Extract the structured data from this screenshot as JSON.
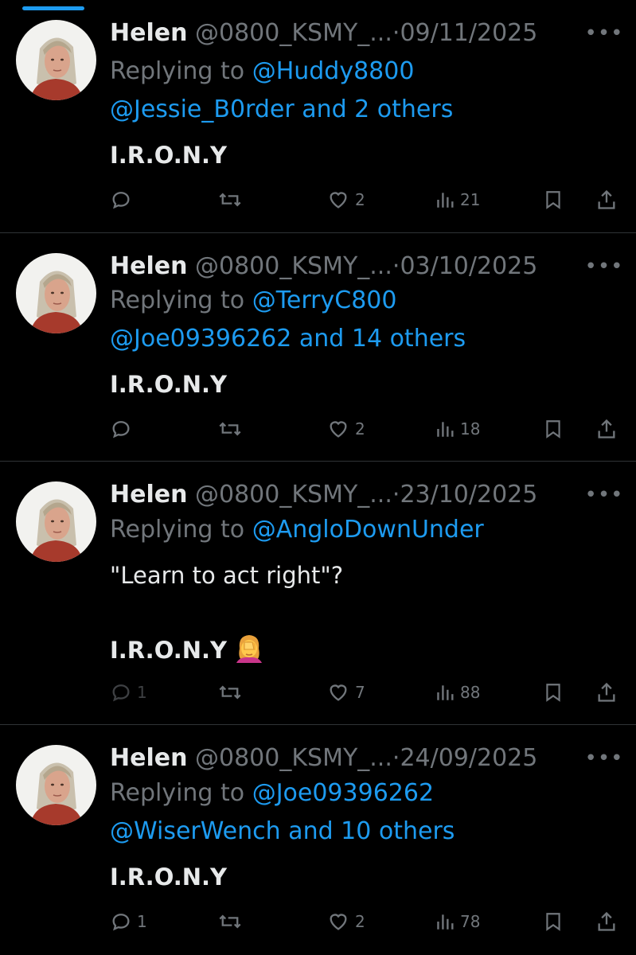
{
  "colors": {
    "background": "#000000",
    "text": "#e7e9ea",
    "muted": "#71767b",
    "accent": "#1d9bf0",
    "divider": "#2f3336"
  },
  "icons": {
    "reply": "reply-bubble-icon",
    "retweet": "retweet-icon",
    "like": "heart-icon",
    "views": "views-bar-chart-icon",
    "bookmark": "bookmark-icon",
    "share": "share-icon",
    "more": "more-dots-icon"
  },
  "tweets": [
    {
      "name": "Helen",
      "handle": "@0800_KSMY_...",
      "separator": "·",
      "date": "09/11/2025",
      "replying_label": "Replying to",
      "replying_first": "@Huddy8800",
      "replying_more": "@Jessie_B0rder and 2 others",
      "text_lines": [
        "I.R.O.N.Y"
      ],
      "reply_count": "",
      "like_count": "2",
      "view_count": "21"
    },
    {
      "name": "Helen",
      "handle": "@0800_KSMY_...",
      "separator": "·",
      "date": "03/10/2025",
      "replying_label": "Replying to",
      "replying_first": "@TerryC800",
      "replying_more": "@Joe09396262 and 14 others",
      "text_lines": [
        "I.R.O.N.Y"
      ],
      "reply_count": "",
      "like_count": "2",
      "view_count": "18"
    },
    {
      "name": "Helen",
      "handle": "@0800_KSMY_...",
      "separator": "·",
      "date": "23/10/2025",
      "replying_label": "Replying to",
      "replying_first": "@AngloDownUnder",
      "replying_more": "",
      "quote_text": "\"Learn to act right\"?",
      "text_lines": [
        "I.R.O.N.Y"
      ],
      "emoji": "woman-facepalming-emoji",
      "reply_count": "1",
      "like_count": "7",
      "view_count": "88"
    },
    {
      "name": "Helen",
      "handle": "@0800_KSMY_...",
      "separator": "·",
      "date": "24/09/2025",
      "replying_label": "Replying to",
      "replying_first": "@Joe09396262",
      "replying_more": "@WiserWench and 10 others",
      "text_lines": [
        "I.R.O.N.Y"
      ],
      "reply_count": "1",
      "like_count": "2",
      "view_count": "78"
    }
  ]
}
